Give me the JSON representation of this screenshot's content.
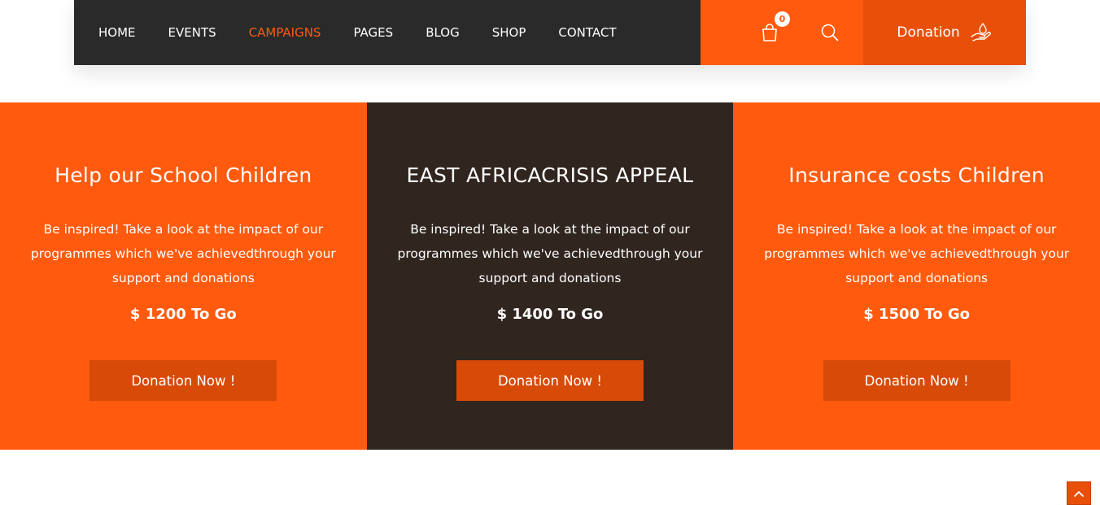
{
  "nav": {
    "items": [
      {
        "label": "HOME",
        "active": false
      },
      {
        "label": "EVENTS",
        "active": false
      },
      {
        "label": "CAMPAIGNS",
        "active": true
      },
      {
        "label": "PAGES",
        "active": false
      },
      {
        "label": "BLOG",
        "active": false
      },
      {
        "label": "SHOP",
        "active": false
      },
      {
        "label": "CONTACT",
        "active": false
      }
    ],
    "cart_count": "0",
    "cart_icon": "shopping-bag-icon",
    "search_icon": "search-icon",
    "donation_label": "Donation",
    "donation_icon": "hand-drop-icon"
  },
  "campaigns": [
    {
      "title": "Help our School Children",
      "text": "Be inspired! Take a look at the impact of our programmes which we've achievedthrough your support and donations",
      "goal": "$ 1200 To Go",
      "button": "Donation Now !"
    },
    {
      "title": "EAST AFRICACRISIS APPEAL",
      "text": "Be inspired! Take a look at the impact of our programmes which we've achievedthrough your support and donations",
      "goal": "$ 1400 To Go",
      "button": "Donation Now !"
    },
    {
      "title": "Insurance costs Children",
      "text": "Be inspired! Take a look at the impact of our programmes which we've achievedthrough your support and donations",
      "goal": "$ 1500 To Go",
      "button": "Donation Now !"
    }
  ],
  "back_to_top_icon": "chevron-up-icon",
  "colors": {
    "accent": "#ff5a0d",
    "accent_dark": "#d74a08",
    "nav_dark": "#2a2a2a",
    "card_dark": "#30251f"
  }
}
